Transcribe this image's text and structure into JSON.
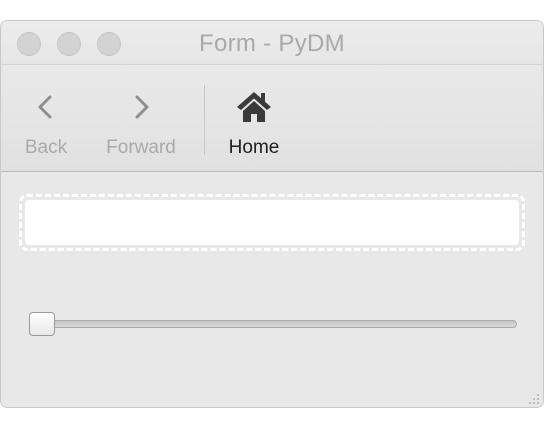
{
  "window": {
    "title": "Form - PyDM"
  },
  "toolbar": {
    "back_label": "Back",
    "forward_label": "Forward",
    "home_label": "Home"
  },
  "form": {
    "line_edit_value": "",
    "slider_value_fraction": 0.0
  },
  "colors": {
    "window_bg": "#ebebeb",
    "disabled_text": "#a9a9a9",
    "active_text": "#1e1e1e"
  },
  "icons": {
    "back": "chevron-left-icon",
    "forward": "chevron-right-icon",
    "home": "home-icon"
  }
}
